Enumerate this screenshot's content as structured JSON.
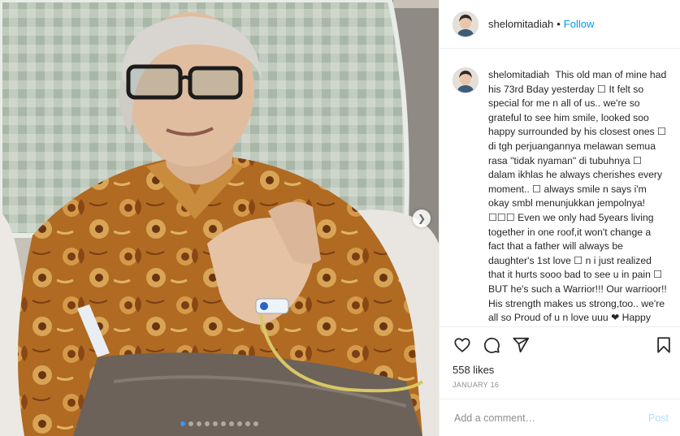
{
  "post": {
    "username": "shelomitadiah",
    "separator": "•",
    "follow_label": "Follow",
    "caption": "This old man of mine had his 73rd Bday yesterday ☐ It felt so special for me n all of us.. we're so grateful to see him smile, looked soo happy surrounded by his closest ones ☐ di tgh perjuangannya melawan semua rasa \"tidak nyaman\" di tubuhnya ☐ dalam ikhlas he always cherishes every moment.. ☐ always smile n says i'm okay smbl menunjukkan jempolnya! ☐☐☐ Even we only had 5years living together in one roof,it won't change a fact that a father will always be daughter's 1st love ☐ n i just realized that it hurts sooo bad to see u in pain ☐ BUT he's such a Warrior!!! Our warrioor!! His strength makes us strong,too.. we're all so Proud of u n love uuu ❤ Happy Bday lg papa ☐☐☐☐☐",
    "likes": "558 likes",
    "date": "JANUARY 16",
    "comment_placeholder": "Add a comment…",
    "post_button": "Post"
  },
  "carousel": {
    "next_icon": "chevron-right-icon",
    "slide_count": 10,
    "active_index": 0
  },
  "icons": {
    "like": "heart-icon",
    "comment": "comment-icon",
    "share": "paper-plane-icon",
    "save": "bookmark-icon"
  },
  "colors": {
    "link_blue": "#0095f6",
    "post_disabled": "#b2dffc",
    "muted": "#8e8e8e",
    "active_dot": "#3897f0"
  }
}
